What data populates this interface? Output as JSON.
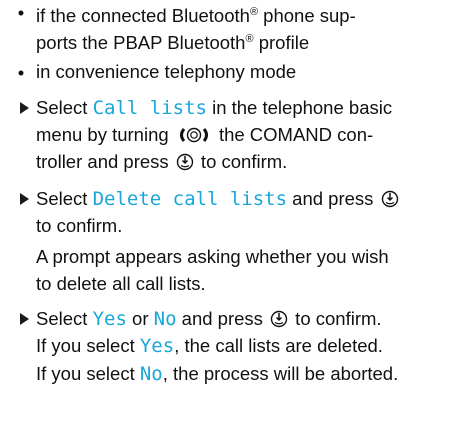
{
  "conditions": [
    {
      "line1_a": "if the connected Bluetooth",
      "sup": "®",
      "line1_b": " phone sup-",
      "line2_a": "ports the PBAP Bluetooth",
      "line2_b": " profile"
    },
    {
      "line1": "in convenience telephony mode"
    }
  ],
  "steps": {
    "s1": {
      "pre": "Select ",
      "code": "Call lists",
      "post": " in the telephone basic",
      "l2_a": "menu by turning ",
      "l2_b": " the COMAND con-",
      "l3_a": "troller and press ",
      "l3_b": " to confirm."
    },
    "s2": {
      "pre": "Select ",
      "code": "Delete call lists",
      "post": " and press ",
      "l2": "to confirm.",
      "l3": "A prompt appears asking whether you wish",
      "l4": "to delete all call lists."
    },
    "s3": {
      "pre": "Select ",
      "code_yes": "Yes",
      "mid": " or ",
      "code_no": "No",
      "post": " and press ",
      "post2": " to confirm.",
      "l2_a": "If you select ",
      "l2_yes": "Yes",
      "l2_b": ", the call lists are deleted.",
      "l3_a": "If you select ",
      "l3_no": "No",
      "l3_b": ", the process will be aborted."
    }
  },
  "icons": {
    "rotate": "controller-rotate-icon",
    "press": "controller-press-icon"
  },
  "colors": {
    "code_text": "#1aa6d9"
  }
}
